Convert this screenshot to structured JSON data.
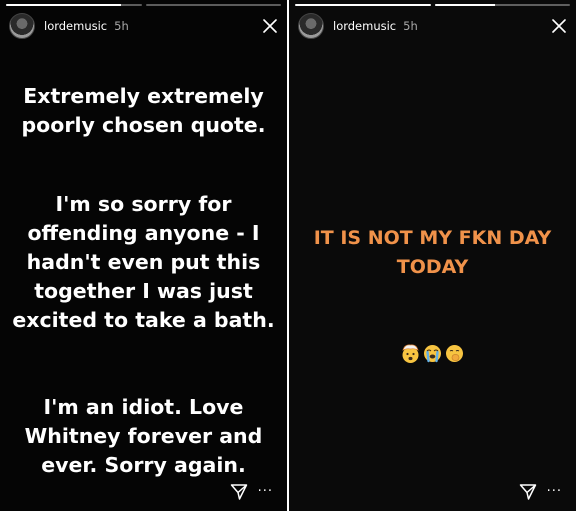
{
  "left_story": {
    "progress": [
      0.85,
      0.0
    ],
    "username": "lordemusic",
    "time": "5h",
    "paragraphs": [
      [
        "Extremely extremely",
        "poorly chosen quote."
      ],
      [
        "I'm so sorry for",
        "offending anyone - I",
        "hadn't even put this",
        "together I was just",
        "excited to take a bath."
      ],
      [
        "I'm an idiot. Love",
        "Whitney forever and",
        "ever. Sorry again."
      ]
    ],
    "more_label": "···"
  },
  "right_story": {
    "progress": [
      1.0,
      0.45
    ],
    "username": "lordemusic",
    "time": "5h",
    "headline": [
      "IT IS NOT MY FKN DAY",
      "TODAY"
    ],
    "text_color": "#f0924a",
    "emojis": [
      "exploding-head-emoji",
      "loudly-crying-face-emoji",
      "hand-over-mouth-emoji"
    ],
    "more_label": "···"
  }
}
